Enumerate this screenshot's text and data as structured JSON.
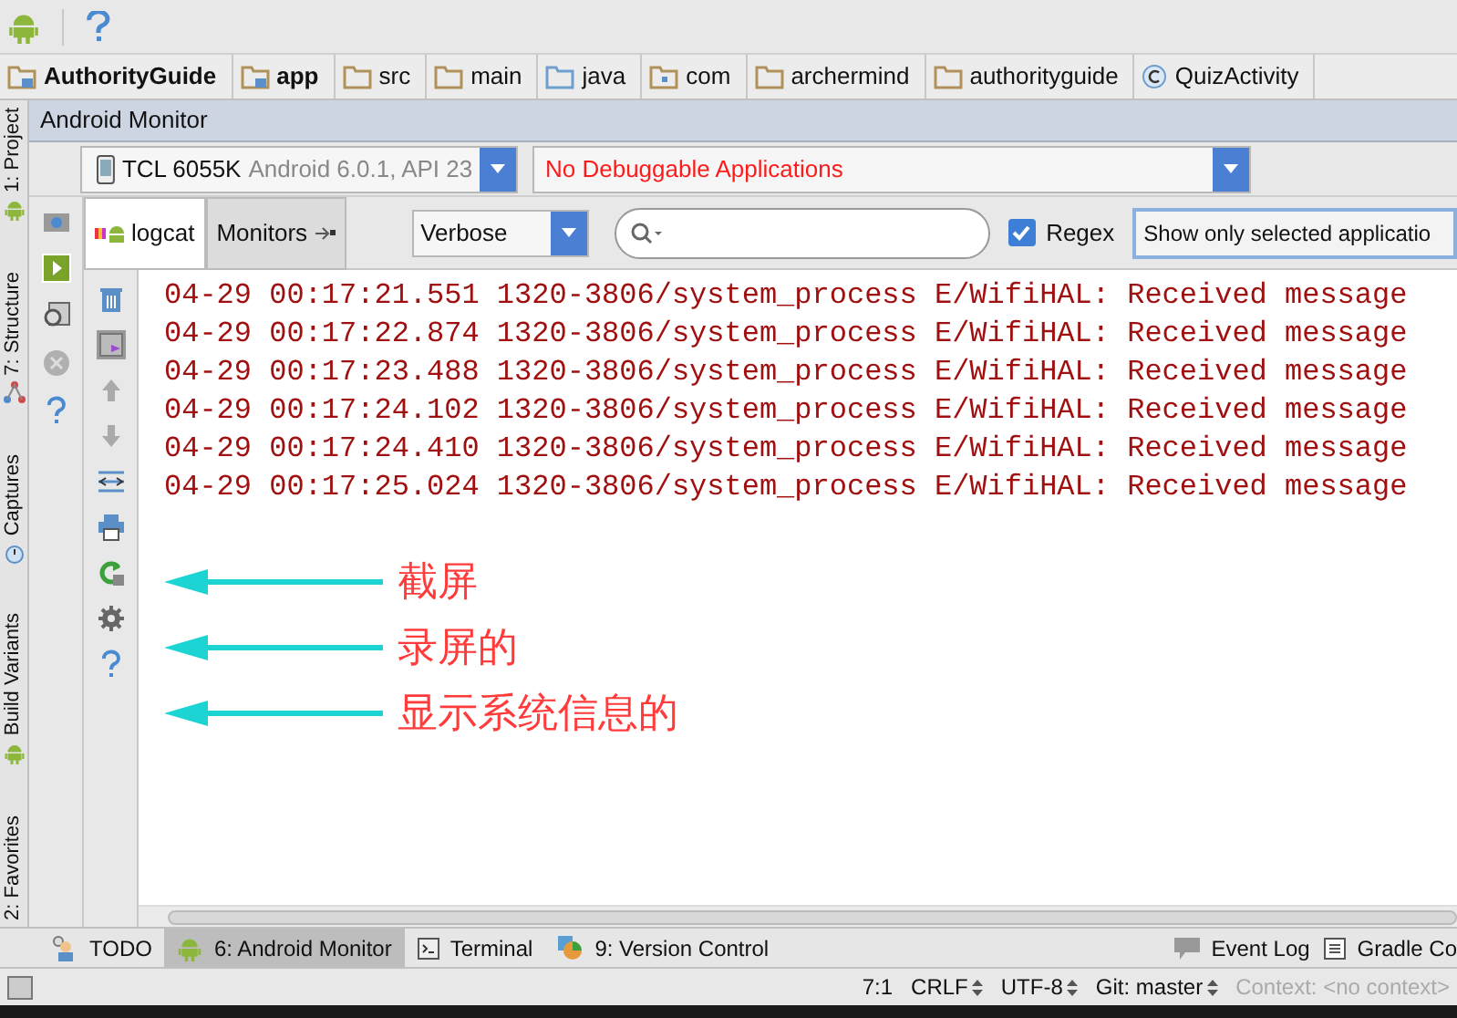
{
  "breadcrumbs": [
    {
      "label": "AuthorityGuide",
      "bold": true,
      "kind": "module"
    },
    {
      "label": "app",
      "bold": true,
      "kind": "module"
    },
    {
      "label": "src",
      "bold": false,
      "kind": "folder"
    },
    {
      "label": "main",
      "bold": false,
      "kind": "folder"
    },
    {
      "label": "java",
      "bold": false,
      "kind": "source"
    },
    {
      "label": "com",
      "bold": false,
      "kind": "package"
    },
    {
      "label": "archermind",
      "bold": false,
      "kind": "folder"
    },
    {
      "label": "authorityguide",
      "bold": false,
      "kind": "folder"
    },
    {
      "label": "QuizActivity",
      "bold": false,
      "kind": "class"
    }
  ],
  "left_tool_strip": [
    {
      "label": "1: Project",
      "kind": "project"
    },
    {
      "label": "7: Structure",
      "kind": "structure"
    },
    {
      "label": "Captures",
      "kind": "captures"
    },
    {
      "label": "Build Variants",
      "kind": "variants"
    },
    {
      "label": "2: Favorites",
      "kind": "favorites"
    }
  ],
  "panel": {
    "title": "Android Monitor",
    "device": {
      "name": "TCL 6055K",
      "detail": "Android 6.0.1, API 23"
    },
    "app_select": "No Debuggable Applications",
    "tabs": [
      {
        "label": "logcat",
        "selected": true
      },
      {
        "label": "Monitors",
        "selected": false
      }
    ],
    "log_level": "Verbose",
    "regex": {
      "label": "Regex",
      "checked": true
    },
    "filter": "Show only selected applicatio"
  },
  "log_lines": [
    "04-29 00:17:21.551 1320-3806/system_process E/WifiHAL: Received message",
    "04-29 00:17:22.874 1320-3806/system_process E/WifiHAL: Received message",
    "04-29 00:17:23.488 1320-3806/system_process E/WifiHAL: Received message",
    "04-29 00:17:24.102 1320-3806/system_process E/WifiHAL: Received message",
    "04-29 00:17:24.410 1320-3806/system_process E/WifiHAL: Received message",
    "04-29 00:17:25.024 1320-3806/system_process E/WifiHAL: Received message"
  ],
  "annotations": [
    "截屏",
    "录屏的",
    "显示系统信息的"
  ],
  "bottom_tabs": [
    {
      "label": "TODO",
      "selected": false,
      "kind": "todo"
    },
    {
      "label": "6: Android Monitor",
      "selected": true,
      "kind": "android"
    },
    {
      "label": "Terminal",
      "selected": false,
      "kind": "terminal"
    },
    {
      "label": "9: Version Control",
      "selected": false,
      "kind": "vcs"
    }
  ],
  "right_tabs": [
    {
      "label": "Event Log",
      "kind": "event"
    },
    {
      "label": "Gradle Co",
      "kind": "gradle"
    }
  ],
  "status_bar": {
    "items": [
      "7:1",
      "CRLF",
      "UTF-8",
      "Git: master"
    ],
    "context": "Context: <no context>"
  }
}
